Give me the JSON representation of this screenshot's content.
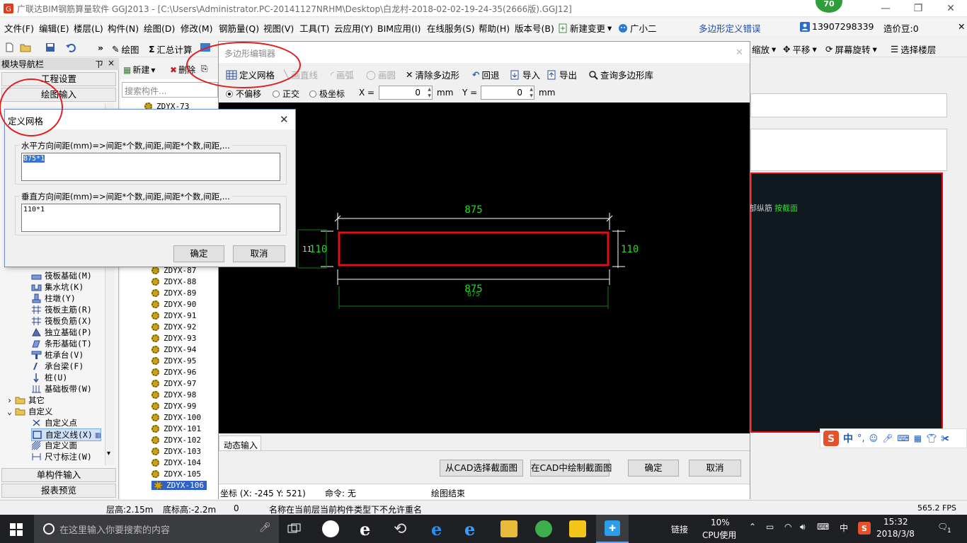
{
  "window": {
    "title": "广联达BIM钢筋算量软件 GGJ2013 - [C:\\Users\\Administrator.PC-20141127NRHM\\Desktop\\白龙村-2018-02-02-19-24-35(2666版).GGJ12]",
    "badge": "70"
  },
  "menu": {
    "items": [
      "文件(F)",
      "编辑(E)",
      "楼层(L)",
      "构件(N)",
      "绘图(D)",
      "修改(M)",
      "钢筋量(Q)",
      "视图(V)",
      "工具(T)",
      "云应用(Y)",
      "BIM应用(I)",
      "在线服务(S)",
      "帮助(H)",
      "版本号(B)"
    ],
    "new_change": "新建变更",
    "assistant": "广小二",
    "poly_error": "多边形定义错误",
    "phone": "13907298339",
    "bean": "造价豆:0"
  },
  "toolbar": {
    "draw": "绘图",
    "summary": "汇总计算",
    "zoom": "缩放",
    "pan": "平移",
    "rotate": "屏幕旋转",
    "select_floor": "选择楼层"
  },
  "nav": {
    "header": "模块导航栏",
    "pin": "ㄗ",
    "close": "×",
    "project_settings": "工程设置",
    "draw_input": "绘图输入",
    "items": [
      {
        "label": "筏板基础(M)",
        "icon": "raft-foundation-icon"
      },
      {
        "label": "集水坑(K)",
        "icon": "sump-pit-icon"
      },
      {
        "label": "柱墩(Y)",
        "icon": "column-pier-icon"
      },
      {
        "label": "筏板主筋(R)",
        "icon": "raft-main-rebar-icon"
      },
      {
        "label": "筏板负筋(X)",
        "icon": "raft-neg-rebar-icon"
      },
      {
        "label": "独立基础(P)",
        "icon": "isolated-footing-icon"
      },
      {
        "label": "条形基础(T)",
        "icon": "strip-footing-icon"
      },
      {
        "label": "桩承台(V)",
        "icon": "pile-cap-icon"
      },
      {
        "label": "承台梁(F)",
        "icon": "cap-beam-icon"
      },
      {
        "label": "桩(U)",
        "icon": "pile-icon"
      },
      {
        "label": "基础板带(W)",
        "icon": "foundation-strip-icon"
      }
    ],
    "other": "其它",
    "custom": "自定义",
    "custom_items": [
      {
        "label": "自定义点",
        "icon": "custom-point-icon"
      },
      {
        "label": "自定义线(X)",
        "icon": "custom-line-icon"
      },
      {
        "label": "自定义面",
        "icon": "custom-face-icon"
      },
      {
        "label": "尺寸标注(W)",
        "icon": "dimension-icon"
      }
    ],
    "single_input": "单构件输入",
    "report_preview": "报表预览"
  },
  "components": {
    "new": "新建",
    "delete": "删除",
    "search_placeholder": "搜索构件...",
    "top_item": "ZDYX-73",
    "items": [
      "ZDYX-87",
      "ZDYX-88",
      "ZDYX-89",
      "ZDYX-90",
      "ZDYX-91",
      "ZDYX-92",
      "ZDYX-93",
      "ZDYX-94",
      "ZDYX-95",
      "ZDYX-96",
      "ZDYX-97",
      "ZDYX-98",
      "ZDYX-99",
      "ZDYX-100",
      "ZDYX-101",
      "ZDYX-102",
      "ZDYX-103",
      "ZDYX-104",
      "ZDYX-105",
      "ZDYX-106"
    ],
    "selected": "ZDYX-106"
  },
  "right_panel": {
    "text_a": "部纵筋",
    "text_b": "按截面"
  },
  "poly_editor": {
    "title": "多边形编辑器",
    "tools": {
      "define_grid": "定义网格",
      "line": "画直线",
      "arc": "画弧",
      "circle": "画圆",
      "clear": "清除多边形",
      "undo": "回退",
      "import": "导入",
      "export": "导出",
      "query": "查询多边形库"
    },
    "options": {
      "no_offset": "不偏移",
      "ortho": "正交",
      "polar": "极坐标",
      "x_label": "X =",
      "x_value": "0",
      "y_label": "Y =",
      "y_value": "0",
      "unit": "mm"
    },
    "dims": {
      "top": "875",
      "bottom": "875",
      "left": "110",
      "right": "110",
      "left_small": "11",
      "bottom_small": "875"
    },
    "dynamic_input": "动态输入",
    "buttons": {
      "cad_select": "从CAD选择截面图",
      "cad_draw": "在CAD中绘制截面图",
      "ok": "确定",
      "cancel": "取消"
    },
    "status": {
      "coords": "坐标 (X: -245 Y: 521)",
      "command": "命令: 无",
      "draw_end": "绘图结束"
    }
  },
  "grid_dialog": {
    "title": "定义网格",
    "h_label": "水平方向间距(mm)=>间距*个数,间距,间距*个数,间距,...",
    "h_value": "875*1",
    "v_label": "垂直方向间距(mm)=>间距*个数,间距,间距*个数,间距,...",
    "v_value": "110*1",
    "ok": "确定",
    "cancel": "取消"
  },
  "statusbar": {
    "floor_height": "层高:2.15m",
    "bottom_height": "底标高:-2.2m",
    "zero": "0",
    "message": "名称在当前层当前构件类型下不允许重名",
    "fps": "565.2 FPS"
  },
  "taskbar": {
    "search_placeholder": "在这里输入你要搜索的内容",
    "link": "链接",
    "cpu_pct": "10%",
    "cpu_label": "CPU使用",
    "ime": "中",
    "time": "15:32",
    "date": "2018/3/8",
    "notify_count": "1"
  },
  "ime_bar": {
    "cn": "中",
    "punct": "°,"
  },
  "colors": {
    "canvas_bg": "#000000",
    "poly_red": "#e01010",
    "dim_green": "#22dd22",
    "annotation_red": "#e02020",
    "selection_blue": "#3275d3"
  }
}
